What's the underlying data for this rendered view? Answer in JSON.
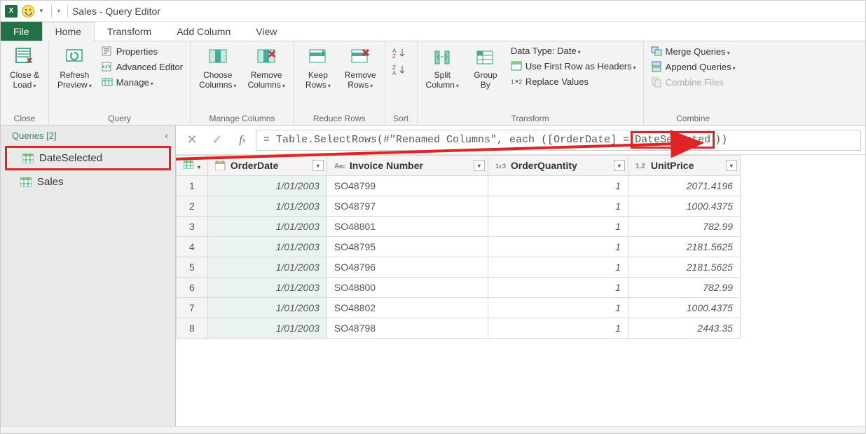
{
  "title": "Sales - Query Editor",
  "tabs": {
    "file": "File",
    "home": "Home",
    "transform": "Transform",
    "addcolumn": "Add Column",
    "view": "View"
  },
  "ribbon": {
    "close": {
      "close_load": "Close &\nLoad",
      "group": "Close"
    },
    "query": {
      "refresh": "Refresh\nPreview",
      "properties": "Properties",
      "advanced": "Advanced Editor",
      "manage": "Manage",
      "group": "Query"
    },
    "managecols": {
      "choose": "Choose\nColumns",
      "remove": "Remove\nColumns",
      "group": "Manage Columns"
    },
    "reducerows": {
      "keep": "Keep\nRows",
      "remove": "Remove\nRows",
      "group": "Reduce Rows"
    },
    "sort": {
      "group": "Sort"
    },
    "transform": {
      "split": "Split\nColumn",
      "groupby": "Group\nBy",
      "datatype": "Data Type: Date",
      "firstrow": "Use First Row as Headers",
      "replace": "Replace Values",
      "group": "Transform"
    },
    "combine": {
      "merge": "Merge Queries",
      "append": "Append Queries",
      "combine_files": "Combine Files",
      "group": "Combine"
    }
  },
  "sidebar": {
    "header": "Queries [2]",
    "items": [
      {
        "label": "DateSelected"
      },
      {
        "label": "Sales"
      }
    ]
  },
  "formula": {
    "prefix": "= Table.SelectRows(#\"Renamed Columns\", each ([OrderDate] = ",
    "highlight": "DateSelected",
    "suffix": "))"
  },
  "columns": [
    {
      "name": "OrderDate",
      "type": "date"
    },
    {
      "name": "Invoice Number",
      "type": "text"
    },
    {
      "name": "OrderQuantity",
      "type": "int"
    },
    {
      "name": "UnitPrice",
      "type": "decimal"
    }
  ],
  "rows": [
    {
      "n": 1,
      "OrderDate": "1/01/2003",
      "Invoice Number": "SO48799",
      "OrderQuantity": "1",
      "UnitPrice": "2071.4196"
    },
    {
      "n": 2,
      "OrderDate": "1/01/2003",
      "Invoice Number": "SO48797",
      "OrderQuantity": "1",
      "UnitPrice": "1000.4375"
    },
    {
      "n": 3,
      "OrderDate": "1/01/2003",
      "Invoice Number": "SO48801",
      "OrderQuantity": "1",
      "UnitPrice": "782.99"
    },
    {
      "n": 4,
      "OrderDate": "1/01/2003",
      "Invoice Number": "SO48795",
      "OrderQuantity": "1",
      "UnitPrice": "2181.5625"
    },
    {
      "n": 5,
      "OrderDate": "1/01/2003",
      "Invoice Number": "SO48796",
      "OrderQuantity": "1",
      "UnitPrice": "2181.5625"
    },
    {
      "n": 6,
      "OrderDate": "1/01/2003",
      "Invoice Number": "SO48800",
      "OrderQuantity": "1",
      "UnitPrice": "782.99"
    },
    {
      "n": 7,
      "OrderDate": "1/01/2003",
      "Invoice Number": "SO48802",
      "OrderQuantity": "1",
      "UnitPrice": "1000.4375"
    },
    {
      "n": 8,
      "OrderDate": "1/01/2003",
      "Invoice Number": "SO48798",
      "OrderQuantity": "1",
      "UnitPrice": "2443.35"
    }
  ]
}
